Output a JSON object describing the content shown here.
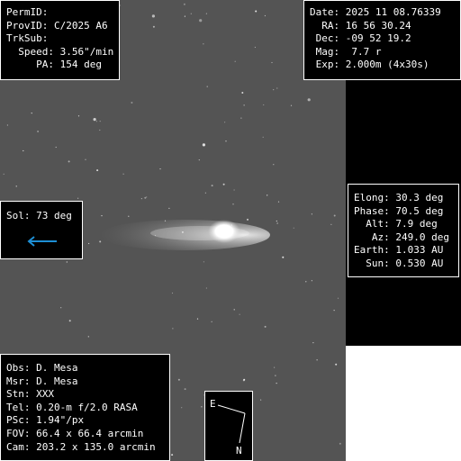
{
  "top_left": {
    "permid": "PermID:",
    "provid": "ProvID: C/2025 A6",
    "trksub": "TrkSub:",
    "speed": "  Speed: 3.56\"/min",
    "pa": "     PA: 154 deg"
  },
  "top_right": {
    "date": "Date: 2025 11 08.76339",
    "ra": "  RA: 16 56 30.24",
    "dec": " Dec: -09 52 19.2",
    "mag": " Mag:  7.7 r",
    "exp": " Exp: 2.000m (4x30s)"
  },
  "sol": {
    "text": "Sol: 73 deg",
    "arrow_color": "#1e90d6"
  },
  "right_mid": {
    "elong": "Elong: 30.3 deg",
    "phase": "Phase: 70.5 deg",
    "alt": "  Alt: 7.9 deg",
    "az": "   Az: 249.0 deg",
    "earth": "Earth: 1.033 AU",
    "sun": "  Sun: 0.530 AU"
  },
  "bottom_left": {
    "obs": "Obs: D. Mesa",
    "msr": "Msr: D. Mesa",
    "stn": "Stn: XXX",
    "tel": "Tel: 0.20-m f/2.0 RASA",
    "psc": "PSc: 1.94\"/px",
    "fov": "FOV: 66.4 x 66.4 arcmin",
    "cam": "Cam: 203.2 x 135.0 arcmin"
  },
  "compass": {
    "east": "E",
    "north": "N"
  }
}
